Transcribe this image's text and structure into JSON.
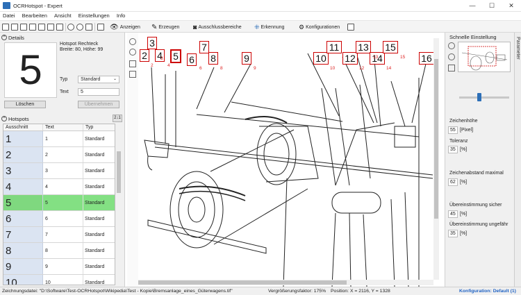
{
  "window": {
    "title": "OCRHotspot - Expert"
  },
  "menu": [
    "Datei",
    "Bearbeiten",
    "Ansicht",
    "Einstellungen",
    "Info"
  ],
  "toolbar": {
    "anzeigen": "Anzeigen",
    "erzeugen": "Erzeugen",
    "ausschluss": "Ausschlussbereiche",
    "erkennung": "Erkennung",
    "konfigurationen": "Konfigurationen"
  },
  "details": {
    "header": "Details",
    "glyph": "5",
    "hotspot_title": "Hotspot Rechteck",
    "hotspot_size": "Breite: 80, Höhe: 99",
    "typ_label": "Typ",
    "typ_value": "Standard",
    "text_label": "Text",
    "text_value": "5",
    "delete_button": "Löschen",
    "apply_button": "Übernehmen"
  },
  "hotspots": {
    "header": "Hotspots",
    "sort_label": "2↓1",
    "columns": [
      "Ausschnitt",
      "Text",
      "Typ"
    ],
    "rows": [
      {
        "glyph": "1",
        "text": "1",
        "typ": "Standard"
      },
      {
        "glyph": "2",
        "text": "2",
        "typ": "Standard"
      },
      {
        "glyph": "3",
        "text": "3",
        "typ": "Standard"
      },
      {
        "glyph": "4",
        "text": "4",
        "typ": "Standard"
      },
      {
        "glyph": "5",
        "text": "5",
        "typ": "Standard"
      },
      {
        "glyph": "6",
        "text": "6",
        "typ": "Standard"
      },
      {
        "glyph": "7",
        "text": "7",
        "typ": "Standard"
      },
      {
        "glyph": "8",
        "text": "8",
        "typ": "Standard"
      },
      {
        "glyph": "9",
        "text": "9",
        "typ": "Standard"
      },
      {
        "glyph": "10",
        "text": "10",
        "typ": "Standard"
      }
    ],
    "selected_row_text": "5"
  },
  "canvas": {
    "hotspot_labels": [
      "2",
      "3",
      "4",
      "5",
      "6",
      "7",
      "8",
      "9",
      "10",
      "11",
      "12",
      "13",
      "14",
      "15",
      "16"
    ],
    "red_numbers": [
      "2",
      "3",
      "4",
      "6",
      "8",
      "9",
      "10",
      "12",
      "13",
      "14",
      "15"
    ]
  },
  "quick": {
    "header": "Schnelle Einstellung",
    "zeichenhoehe_label": "Zeichenhöhe",
    "zeichenhoehe_value": "55",
    "zeichenhoehe_unit": "[Pixel]",
    "toleranz_label": "Toleranz",
    "toleranz_value": "35",
    "toleranz_unit": "[%]",
    "abstand_label": "Zeichenabstand maximal",
    "abstand_value": "62",
    "abstand_unit": "[%]",
    "sicher_label": "Übereinstimmung sicher",
    "sicher_value": "45",
    "sicher_unit": "[%]",
    "ungefaehr_label": "Übereinstimmung ungefähr",
    "ungefaehr_value": "35",
    "ungefaehr_unit": "[%]",
    "slider_fraction": 0.4
  },
  "side_tab": "Parameter",
  "status": {
    "drawing": "Zeichnungsdatei: \"D:\\Software\\Test-OCRHotspot\\Wikipedia\\Test - Kopie\\Bremsanlage_eines_Güterwagens.tif\"",
    "zoom": "Vergrößerungsfaktor: 175%",
    "position": "Position: X = 2116, Y = 1328",
    "config": "Konfiguration: Default (1)"
  },
  "colors": {
    "selected_row": "#7fd87f",
    "hotspot_border": "#cc0000",
    "config_link": "#1f62c4"
  }
}
